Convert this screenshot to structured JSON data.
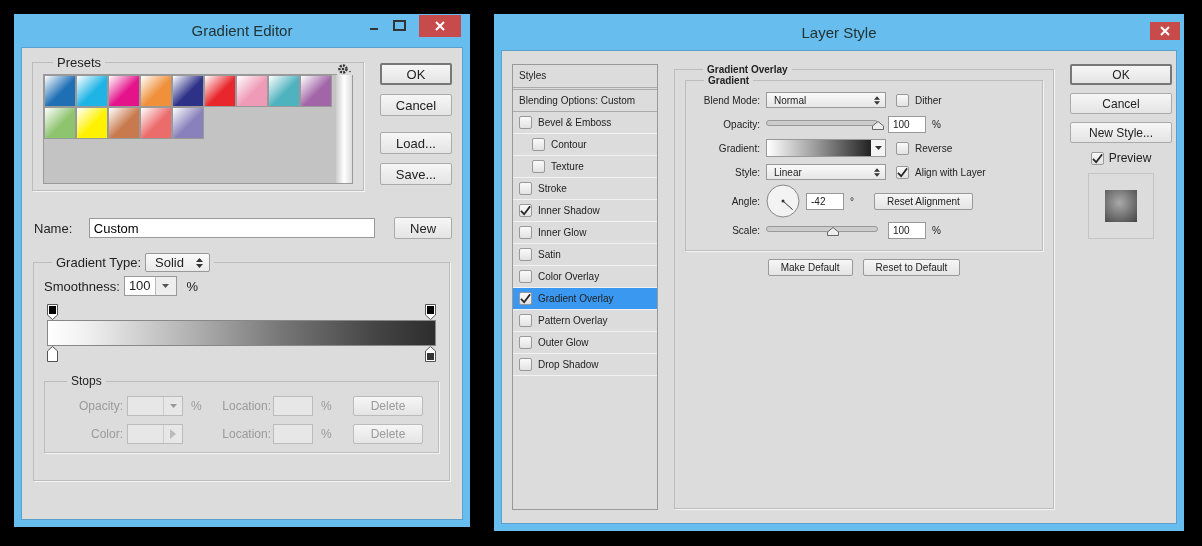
{
  "gradient_editor": {
    "title": "Gradient Editor",
    "presets": {
      "label": "Presets",
      "swatches": [
        {
          "color": "#1f6fb5"
        },
        {
          "color": "#1fb4e6"
        },
        {
          "color": "#e4138a"
        },
        {
          "color": "#f0903a"
        },
        {
          "color": "#2d3187"
        },
        {
          "color": "#e8262b"
        },
        {
          "color": "#ef9ab6"
        },
        {
          "color": "#4fb2bf"
        },
        {
          "color": "#a266a8"
        },
        {
          "color": "#8fc46f"
        },
        {
          "color": "#fff200"
        },
        {
          "color": "#c87a4e"
        },
        {
          "color": "#ec6b6b"
        },
        {
          "color": "#8881bb"
        }
      ]
    },
    "buttons": [
      "OK",
      "Cancel",
      "Load...",
      "Save..."
    ],
    "name": {
      "label": "Name:",
      "value": "Custom",
      "button": "New"
    },
    "gradient_type": {
      "label": "Gradient Type:",
      "value": "Solid"
    },
    "smoothness": {
      "label": "Smoothness:",
      "value": "100",
      "unit": "%"
    },
    "stops": {
      "label": "Stops",
      "disabled": true,
      "rows": [
        {
          "kind": "dropdown",
          "label": "Opacity:",
          "unit": "%",
          "location_label": "Location:",
          "location_unit": "%",
          "button": "Delete"
        },
        {
          "kind": "swatch",
          "label": "Color:",
          "location_label": "Location:",
          "location_unit": "%",
          "button": "Delete"
        }
      ]
    }
  },
  "layer_style": {
    "title": "Layer Style",
    "styles_header": "Styles",
    "blending": "Blending Options: Custom",
    "styles": [
      {
        "label": "Bevel & Emboss",
        "checked": false,
        "selected": false,
        "children": [
          {
            "label": "Contour",
            "checked": false,
            "selected": false
          },
          {
            "label": "Texture",
            "checked": false,
            "selected": false
          }
        ]
      },
      {
        "label": "Stroke",
        "checked": false,
        "selected": false
      },
      {
        "label": "Inner Shadow",
        "checked": true,
        "selected": false
      },
      {
        "label": "Inner Glow",
        "checked": false,
        "selected": false
      },
      {
        "label": "Satin",
        "checked": false,
        "selected": false
      },
      {
        "label": "Color Overlay",
        "checked": false,
        "selected": false
      },
      {
        "label": "Gradient Overlay",
        "checked": true,
        "selected": true
      },
      {
        "label": "Pattern Overlay",
        "checked": false,
        "selected": false
      },
      {
        "label": "Outer Glow",
        "checked": false,
        "selected": false
      },
      {
        "label": "Drop Shadow",
        "checked": false,
        "selected": false
      }
    ],
    "section": "Gradient Overlay",
    "group": "Gradient",
    "blend_mode": {
      "label": "Blend Mode:",
      "value": "Normal"
    },
    "dither": {
      "label": "Dither",
      "checked": false
    },
    "opacity": {
      "label": "Opacity:",
      "level": 1,
      "value": "100",
      "unit": "%"
    },
    "gradient": {
      "label": "Gradient:"
    },
    "reverse": {
      "label": "Reverse",
      "checked": false
    },
    "style": {
      "label": "Style:",
      "value": "Linear"
    },
    "align": {
      "label": "Align with Layer",
      "checked": true
    },
    "angle": {
      "label": "Angle:",
      "value": "-42",
      "unit": "°",
      "button": "Reset Alignment"
    },
    "scale": {
      "label": "Scale:",
      "level": 0.6,
      "value": "100",
      "unit": "%"
    },
    "bottom_buttons": [
      "Make Default",
      "Reset to Default"
    ],
    "buttons": [
      "OK",
      "Cancel",
      "New Style..."
    ],
    "preview": {
      "label": "Preview",
      "checked": true
    }
  }
}
